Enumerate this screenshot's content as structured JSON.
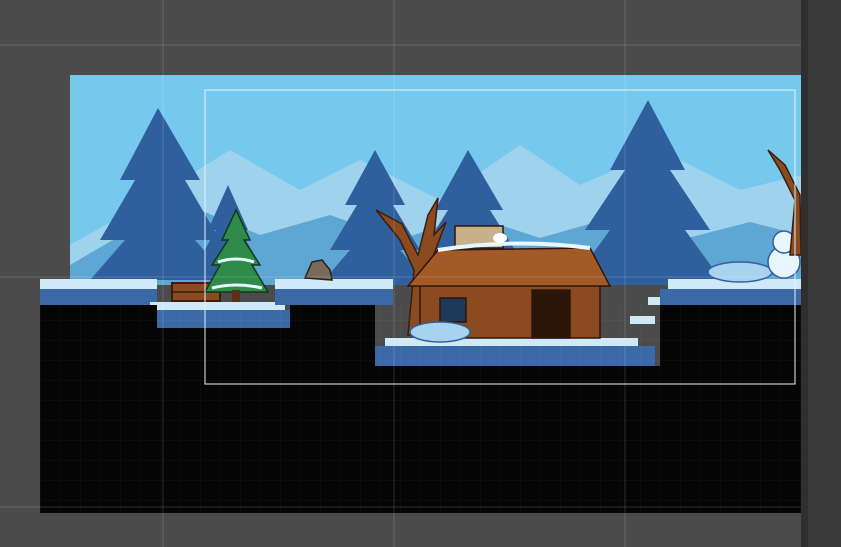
{
  "editor": {
    "grid_visible": true,
    "camera_bounds_visible": true
  },
  "scene": {
    "sky_color": "#76c9ec",
    "far_mountain_color": "#9fd2ec",
    "near_mountain_color": "#5ea6d4",
    "tree_back_color": "#3f78b5",
    "tree_front_color": "#2f5f9c",
    "ground_snow_color": "#cfe9f8",
    "ground_stone_color": "#3b69a8",
    "underground_color": "#050505",
    "hut_wood_color": "#8b4a1f",
    "pine_color": "#2e8b4a",
    "objects": [
      "pine-tree",
      "wooden-crate",
      "rock",
      "dead-tree",
      "log-cabin",
      "bird",
      "snowman",
      "snow-mound"
    ]
  },
  "viewport": {
    "background_color": "#4b4b4b"
  },
  "scrollbar": {
    "color": "#3a3a3a"
  }
}
